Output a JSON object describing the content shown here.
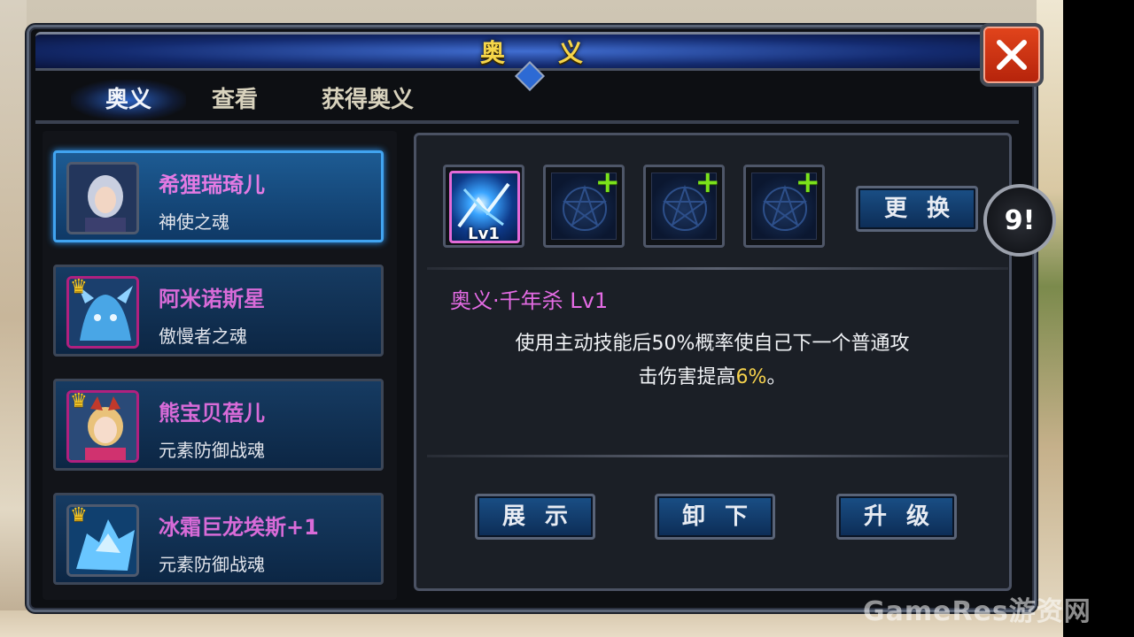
{
  "window": {
    "title": "奥义"
  },
  "tabs": [
    {
      "label": "奥义",
      "active": true
    },
    {
      "label": "查看",
      "active": false
    },
    {
      "label": "获得奥义",
      "active": false
    }
  ],
  "characters": [
    {
      "name": "希狸瑞琦儿",
      "soul": "神使之魂",
      "selected": true,
      "crown": false
    },
    {
      "name": "阿米诺斯星",
      "soul": "傲慢者之魂",
      "selected": false,
      "crown": true
    },
    {
      "name": "熊宝贝蓓儿",
      "soul": "元素防御战魂",
      "selected": false,
      "crown": true
    },
    {
      "name": "冰霜巨龙埃斯+1",
      "soul": "元素防御战魂",
      "selected": false,
      "crown": true
    }
  ],
  "skill_slots": {
    "equipped_level": "Lv1",
    "empty_slot_icon": "plus-icon",
    "replace_label": "更换"
  },
  "skill": {
    "title": "奥义·千年杀 Lv1",
    "desc_part1": "使用主动技能后50%概率使自己下一个普通攻",
    "desc_part2": "击伤害提高",
    "desc_value": "6%",
    "desc_end": "。"
  },
  "actions": {
    "show_label": "展示",
    "remove_label": "卸下",
    "upgrade_label": "升级"
  },
  "side_button": {
    "label": "9!"
  },
  "watermark": "GameRes游资网",
  "colors": {
    "accent_blue": "#1d5b93",
    "name_magenta": "#d86bd8",
    "highlight_gold": "#f6d24c",
    "close_red": "#d0381a",
    "plus_green": "#7be21b"
  }
}
